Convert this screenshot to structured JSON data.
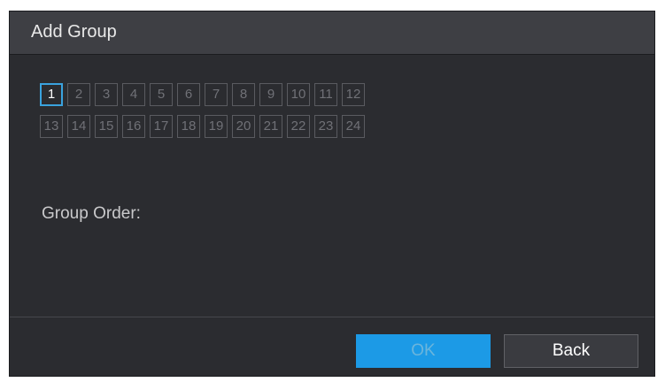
{
  "dialog": {
    "title": "Add Group",
    "channels": {
      "row1": [
        "1",
        "2",
        "3",
        "4",
        "5",
        "6",
        "7",
        "8",
        "9",
        "10",
        "11",
        "12"
      ],
      "row2": [
        "13",
        "14",
        "15",
        "16",
        "17",
        "18",
        "19",
        "20",
        "21",
        "22",
        "23",
        "24"
      ],
      "selected": "1"
    },
    "group_order_label": "Group Order:",
    "group_order_value": "",
    "buttons": {
      "ok_label": "OK",
      "back_label": "Back"
    }
  },
  "colors": {
    "accent": "#1c9ae6",
    "selected_border": "#3aa3df",
    "dialog_bg": "#2b2c30",
    "titlebar_bg": "#3e3f44"
  }
}
